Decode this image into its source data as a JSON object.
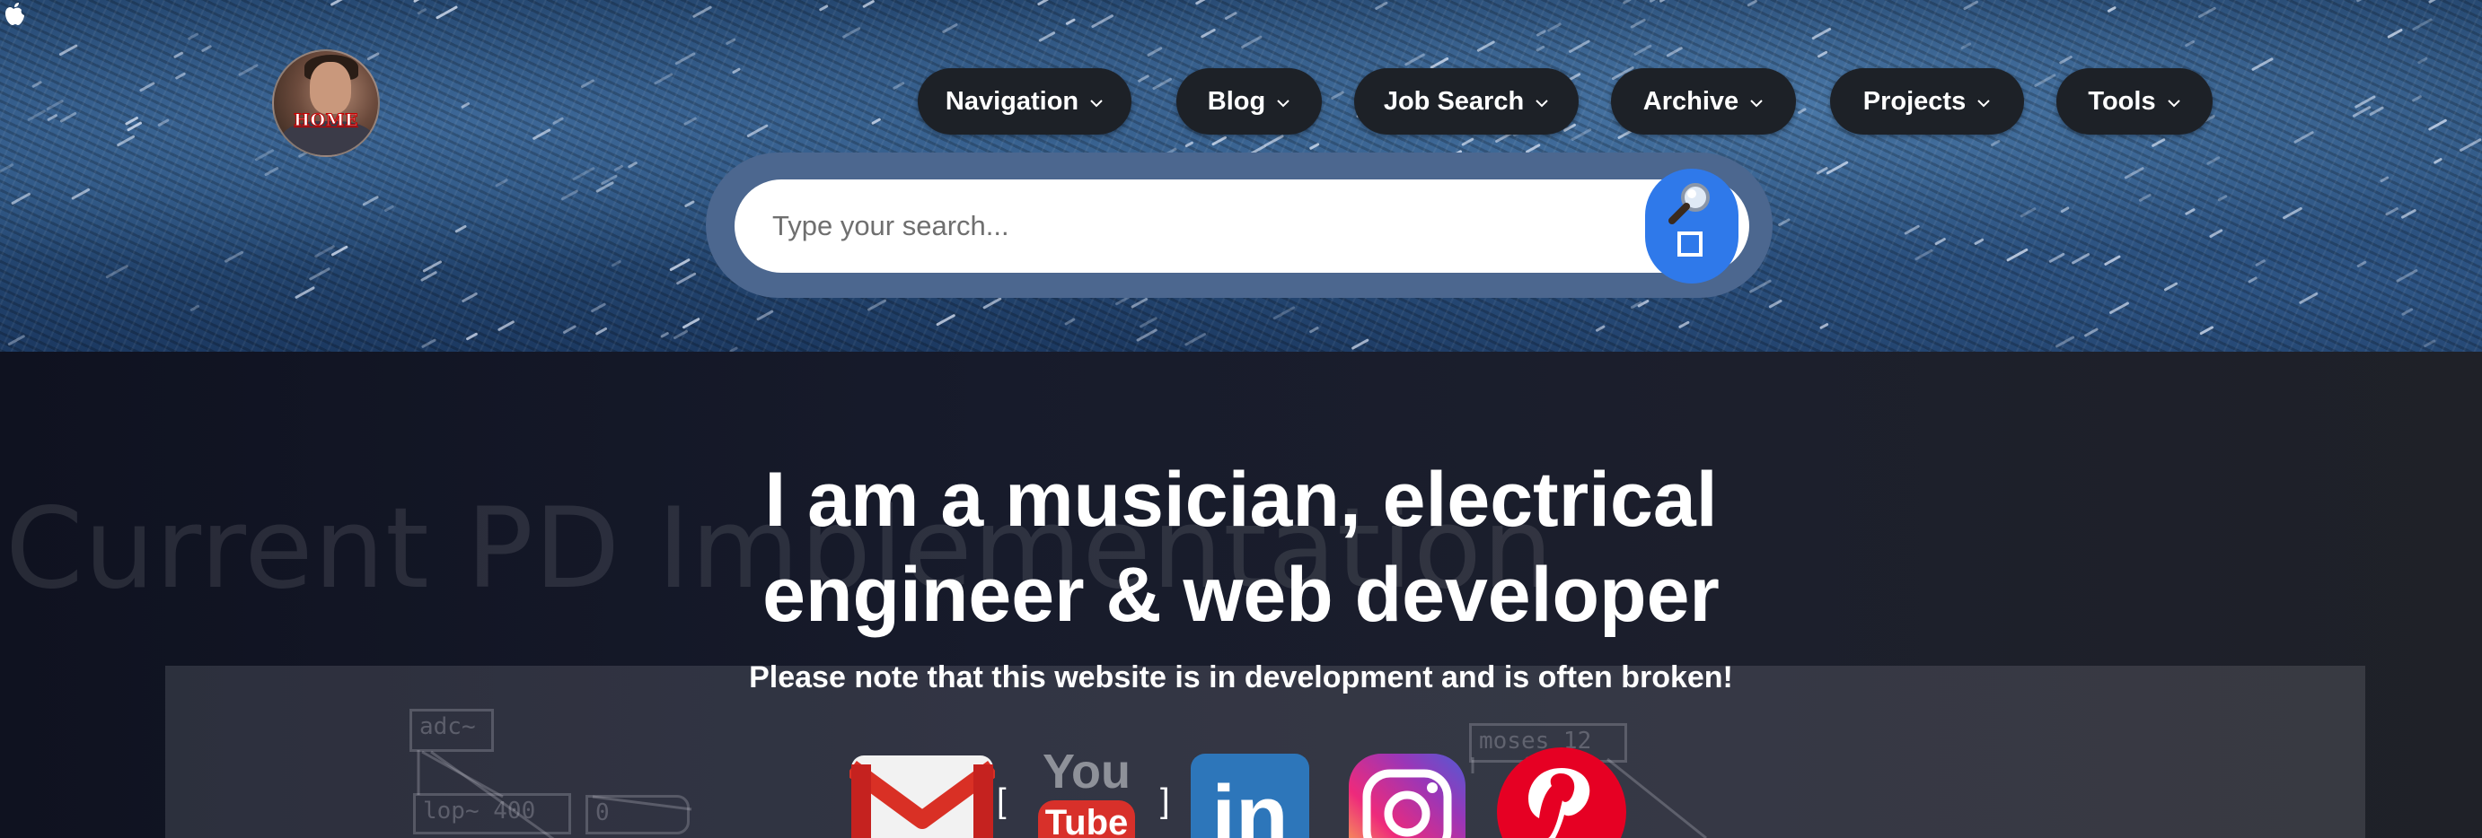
{
  "header": {
    "logo_icon": "apple-logo-icon",
    "avatar_label": "HOME",
    "nav": [
      {
        "label": "Navigation"
      },
      {
        "label": "Blog"
      },
      {
        "label": "Job Search"
      },
      {
        "label": "Archive"
      },
      {
        "label": "Projects"
      },
      {
        "label": "Tools"
      }
    ],
    "search": {
      "placeholder": "Type your search...",
      "button_icon": "magnifier-icon"
    }
  },
  "hero": {
    "background_title": "Current PD Implementation",
    "pd_objects": [
      "adc~",
      "lop~ 400",
      "0",
      "moses 12"
    ],
    "title_line1": "I am a musician, electrical",
    "title_line2": "engineer & web developer",
    "subtitle": "Please note that this website is in development and is often broken!",
    "social": {
      "gmail": "gmail-icon",
      "bracket_open": "[",
      "youtube_top": "You",
      "youtube_bottom": "Tube",
      "bracket_close": "]",
      "linkedin": "in",
      "instagram": "instagram-icon",
      "pinterest": "pinterest-icon"
    }
  },
  "colors": {
    "nav_pill": "#1d2127",
    "search_button": "#2f79ea",
    "hero_bg": "#171b2b"
  }
}
